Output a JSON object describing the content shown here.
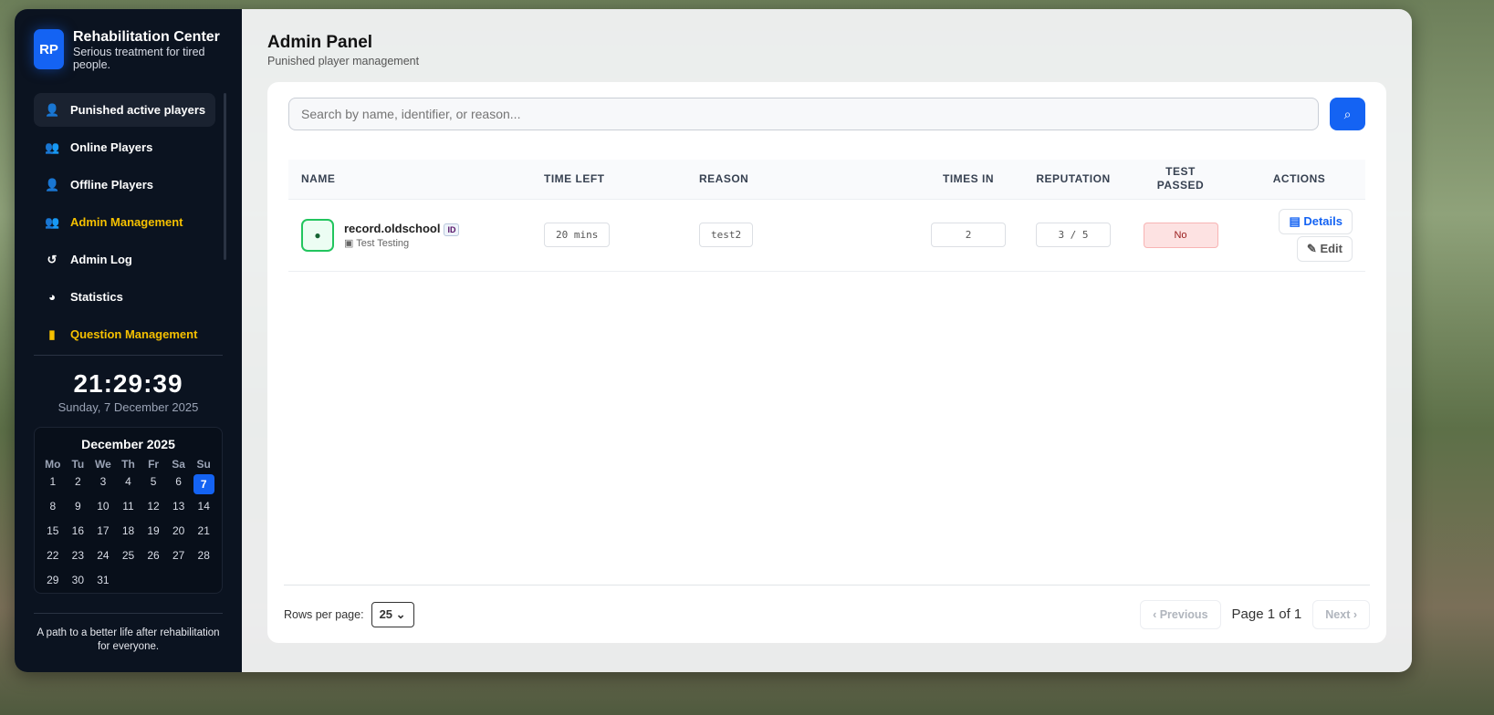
{
  "sidebar": {
    "logo": "RP",
    "title": "Rehabilitation Center",
    "subtitle": "Serious treatment for tired people.",
    "items": [
      {
        "label": "Punished active players",
        "icon": "user-clock-icon"
      },
      {
        "label": "Online Players",
        "icon": "users-icon"
      },
      {
        "label": "Offline Players",
        "icon": "user-clock-icon"
      },
      {
        "label": "Admin Management",
        "icon": "users-cog-icon"
      },
      {
        "label": "Admin Log",
        "icon": "history-icon"
      },
      {
        "label": "Statistics",
        "icon": "chart-pie-icon"
      },
      {
        "label": "Question Management",
        "icon": "file-question-icon"
      }
    ],
    "clock": "21:29:39",
    "date": "Sunday, 7 December 2025",
    "calendar": {
      "title": "December 2025",
      "weekdays": [
        "Mo",
        "Tu",
        "We",
        "Th",
        "Fr",
        "Sa",
        "Su"
      ],
      "days": 31,
      "start_offset": 0,
      "today": 7
    },
    "footer": "A path to a better life after rehabilitation for everyone."
  },
  "header": {
    "title": "Admin Panel",
    "subtitle": "Punished player management"
  },
  "search": {
    "placeholder": "Search by name, identifier, or reason..."
  },
  "table": {
    "columns": [
      "NAME",
      "TIME LEFT",
      "REASON",
      "TIMES IN",
      "REPUTATION",
      "TEST PASSED",
      "ACTIONS"
    ],
    "rows": [
      {
        "name": "record.oldschool",
        "id_badge": "ID",
        "character": "Test Testing",
        "time_left": "20 mins",
        "reason": "test2",
        "times_in": "2",
        "reputation": "3 / 5",
        "test_passed": "No",
        "details": "Details",
        "edit": "Edit"
      }
    ]
  },
  "pagination": {
    "rows_label": "Rows per page:",
    "rows_value": "25",
    "previous": "Previous",
    "page": "Page 1 of 1",
    "next": "Next"
  },
  "colors": {
    "accent": "#1463f3",
    "gold": "#f5c000",
    "sidebar": "#0b1320"
  }
}
